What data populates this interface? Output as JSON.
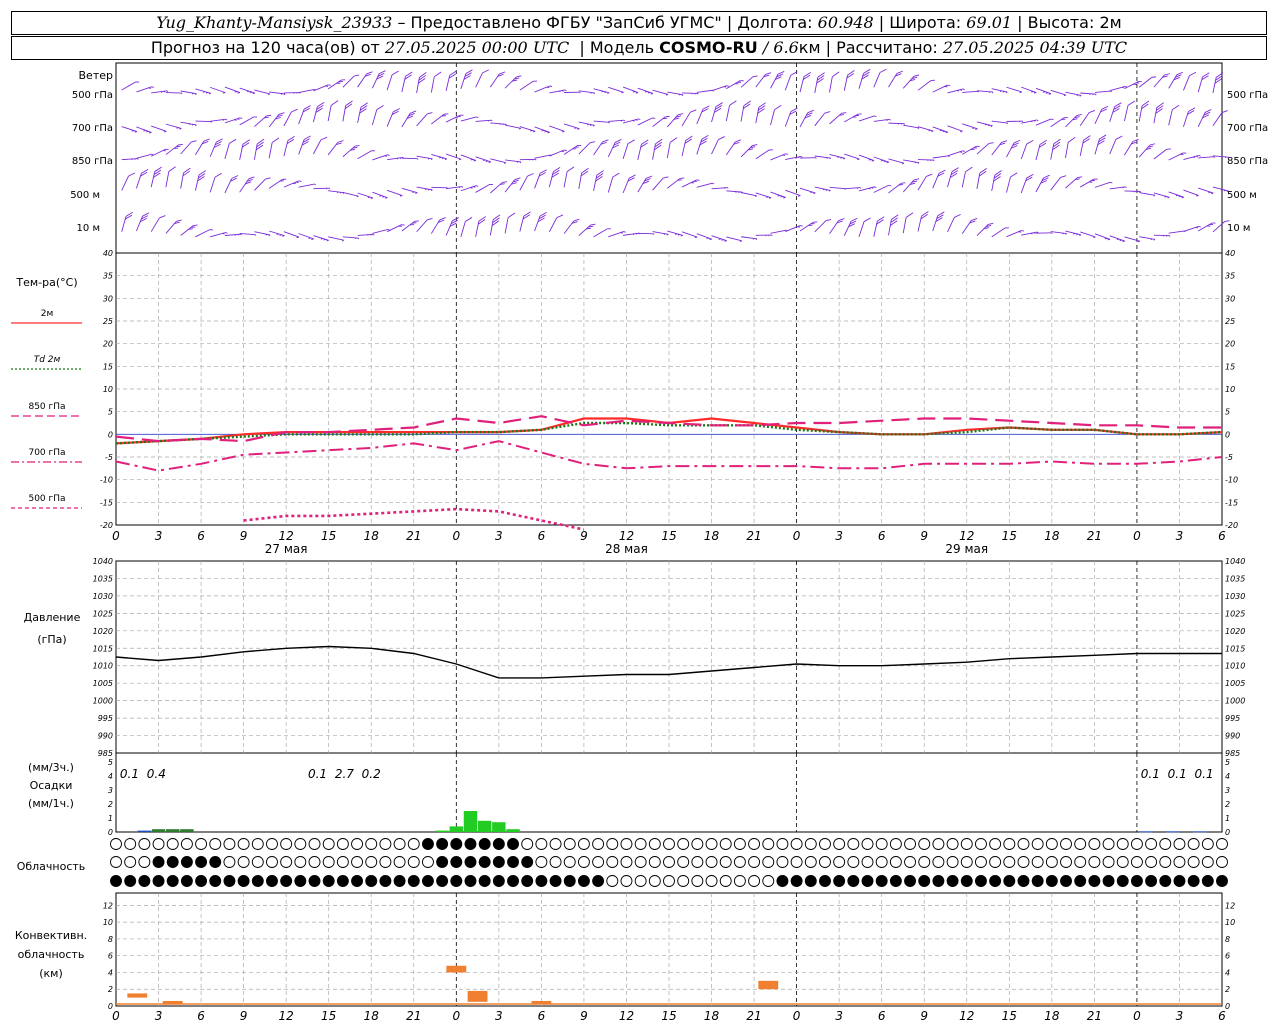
{
  "header": {
    "station": "Yug_Khanty-Mansiysk_23933",
    "provider": "– Предоставлено ФГБУ \"ЗапСиб УГМС\"",
    "lon_label": "Долгота:",
    "lon": "60.948",
    "lat_label": "Широта:",
    "lat": "69.01",
    "alt_label": "Высота:",
    "alt": "2м",
    "forecast_prefix": "Прогноз на 120 часа(ов) от",
    "forecast_start": "27.05.2025 00:00 UTC",
    "model_label": "Модель",
    "model": "COSMO-RU",
    "model_res": "/ 6.6",
    "model_res_unit": "км",
    "calc_label": "Рассчитано:",
    "calc_time": "27.05.2025 04:39 UTC"
  },
  "wind_panel": {
    "title": "Ветер",
    "levels": [
      "500 гПа",
      "700 гПа",
      "850 гПа",
      "500 м",
      "10 м"
    ]
  },
  "temp_panel": {
    "title": "Тем-ра(°С)",
    "legend": [
      {
        "label": "2м",
        "color": "#ff2a2a",
        "style": "solid"
      },
      {
        "label": "Td 2м",
        "color": "#1a7a1a",
        "style": "dotted"
      },
      {
        "label": "850 гПа",
        "color": "#e0207a",
        "style": "long-dash"
      },
      {
        "label": "700 гПа",
        "color": "#e0207a",
        "style": "dash-dot"
      },
      {
        "label": "500 гПа",
        "color": "#e0207a",
        "style": "short-dash"
      }
    ],
    "yticks": [
      "40",
      "35",
      "30",
      "25",
      "20",
      "15",
      "10",
      "5",
      "0",
      "-5",
      "-10",
      "-15",
      "-20"
    ]
  },
  "time_axis": {
    "hour_labels": [
      "0",
      "3",
      "6",
      "9",
      "12",
      "15",
      "18",
      "21",
      "0",
      "3",
      "6",
      "9",
      "12",
      "15",
      "18",
      "21",
      "0",
      "3",
      "6",
      "9",
      "12",
      "15",
      "18",
      "21",
      "0",
      "3",
      "6"
    ],
    "days": [
      "27 мая",
      "28 мая",
      "29 мая"
    ]
  },
  "pressure_panel": {
    "title": "Давление",
    "unit": "(гПа)",
    "yticks": [
      "1040",
      "1035",
      "1030",
      "1025",
      "1020",
      "1015",
      "1010",
      "1005",
      "1000",
      "995",
      "990",
      "985"
    ]
  },
  "precip_panel": {
    "unit_top": "(мм/3ч.)",
    "title": "Осадки",
    "unit_bottom": "(мм/1ч.)",
    "yticks": [
      "5",
      "4",
      "3",
      "2",
      "1",
      "0"
    ],
    "amounts": [
      {
        "hour": 1.5,
        "text": "0.1"
      },
      {
        "hour": 4.5,
        "text": "0.4"
      },
      {
        "hour": 22.5,
        "text": "0.1"
      },
      {
        "hour": 25.5,
        "text": "2.7"
      },
      {
        "hour": 28.5,
        "text": "0.2"
      },
      {
        "hour": 115.5,
        "text": "0.1"
      },
      {
        "hour": 118.5,
        "text": "0.1"
      },
      {
        "hour": 121.5,
        "text": "0.1"
      }
    ]
  },
  "cloud_panel": {
    "title": "Облачность"
  },
  "conv_panel": {
    "title_1": "Конвективн.",
    "title_2": "облачность",
    "unit": "(км)",
    "yticks": [
      "12",
      "10",
      "8",
      "6",
      "4",
      "2",
      "0"
    ]
  },
  "chart_data": [
    {
      "type": "line",
      "title": "Тем-ра(°С)",
      "ylim": [
        -20,
        40
      ],
      "x_hours": [
        0,
        3,
        6,
        9,
        12,
        15,
        18,
        21,
        24,
        27,
        30,
        33,
        36,
        39,
        42,
        45,
        48,
        51,
        54,
        57,
        60,
        63,
        66,
        69,
        72,
        75,
        78
      ],
      "series": [
        {
          "name": "2м",
          "values": [
            -2,
            -1.5,
            -1,
            0,
            0.5,
            0.5,
            0.5,
            0.5,
            0.5,
            0.5,
            1,
            3.5,
            3.5,
            2.5,
            3.5,
            2.5,
            1.5,
            0.5,
            0,
            0,
            1,
            1.5,
            1,
            1,
            0,
            0,
            0.5
          ]
        },
        {
          "name": "Td 2м",
          "values": [
            -2,
            -1.5,
            -1,
            -0.5,
            0,
            0,
            0,
            0,
            0.5,
            0.5,
            1,
            2.5,
            2.5,
            2,
            2,
            2,
            1,
            0.5,
            0,
            0,
            0.5,
            1.5,
            1,
            1,
            0,
            0,
            0.5
          ]
        },
        {
          "name": "850 гПа",
          "values": [
            -0.5,
            -1.5,
            -1,
            -1.5,
            0.5,
            0.5,
            1,
            1.5,
            3.5,
            2.5,
            4,
            2,
            3,
            2.5,
            2,
            2,
            2.5,
            2.5,
            3,
            3.5,
            3.5,
            3,
            2.5,
            2,
            2,
            1.5,
            1.5
          ]
        },
        {
          "name": "700 гПа",
          "values": [
            -6,
            -8,
            -6.5,
            -4.5,
            -4,
            -3.5,
            -3,
            -2,
            -3.5,
            -1.5,
            -4,
            -6.5,
            -7.5,
            -7,
            -7,
            -7,
            -7,
            -7.5,
            -7.5,
            -6.5,
            -6.5,
            -6.5,
            -6,
            -6.5,
            -6.5,
            -6,
            -5
          ]
        },
        {
          "name": "500 гПа",
          "values": [
            null,
            null,
            null,
            -19,
            -18,
            -18,
            -17.5,
            -17,
            -16.5,
            -17,
            -19,
            -21,
            null,
            null,
            null,
            null,
            null,
            null,
            null,
            null,
            null,
            null,
            null,
            null,
            null,
            null,
            null
          ]
        }
      ]
    },
    {
      "type": "line",
      "title": "Давление (гПа)",
      "ylim": [
        985,
        1040
      ],
      "x_hours": [
        0,
        3,
        6,
        9,
        12,
        15,
        18,
        21,
        24,
        27,
        30,
        33,
        36,
        39,
        42,
        45,
        48,
        51,
        54,
        57,
        60,
        63,
        66,
        69,
        72,
        75,
        78
      ],
      "values": [
        1012.5,
        1011.5,
        1012.5,
        1014,
        1015,
        1015.5,
        1015,
        1013.5,
        1010.5,
        1006.5,
        1006.5,
        1007,
        1007.5,
        1007.5,
        1008.5,
        1009.5,
        1010.5,
        1010,
        1010,
        1010.5,
        1011,
        1012,
        1012.5,
        1013,
        1013.5,
        1013.5,
        1013.5
      ]
    },
    {
      "type": "bar",
      "title": "Осадки (мм/1ч.)",
      "ylim": [
        0,
        5
      ],
      "bars": [
        {
          "hour": 2,
          "value": 0.1,
          "color": "#1f4fbf"
        },
        {
          "hour": 3,
          "value": 0.2,
          "color": "#2e7a2e"
        },
        {
          "hour": 4,
          "value": 0.2,
          "color": "#2e7a2e"
        },
        {
          "hour": 5,
          "value": 0.2,
          "color": "#2e7a2e"
        },
        {
          "hour": 23,
          "value": 0.1,
          "color": "#22cc22"
        },
        {
          "hour": 24,
          "value": 0.4,
          "color": "#22cc22"
        },
        {
          "hour": 25,
          "value": 1.5,
          "color": "#22cc22"
        },
        {
          "hour": 26,
          "value": 0.8,
          "color": "#22cc22"
        },
        {
          "hour": 27,
          "value": 0.7,
          "color": "#22cc22"
        },
        {
          "hour": 28,
          "value": 0.2,
          "color": "#22cc22"
        },
        {
          "hour": 115,
          "value": 0.05,
          "color": "#1f4fbf"
        },
        {
          "hour": 118,
          "value": 0.05,
          "color": "#1f4fbf"
        },
        {
          "hour": 121,
          "value": 0.05,
          "color": "#1f4fbf"
        }
      ]
    },
    {
      "type": "bar",
      "title": "Конвективн. облачность (км)",
      "ylim": [
        0,
        13
      ],
      "bars": [
        {
          "hour": 1.5,
          "base": 1,
          "top": 1.5
        },
        {
          "hour": 4,
          "base": 0.2,
          "top": 0.6
        },
        {
          "hour": 24,
          "base": 4,
          "top": 4.8
        },
        {
          "hour": 25.5,
          "base": 0.5,
          "top": 1.8
        },
        {
          "hour": 46,
          "base": 2,
          "top": 3
        },
        {
          "hour": 30,
          "base": 0.3,
          "top": 0.6
        }
      ]
    }
  ]
}
